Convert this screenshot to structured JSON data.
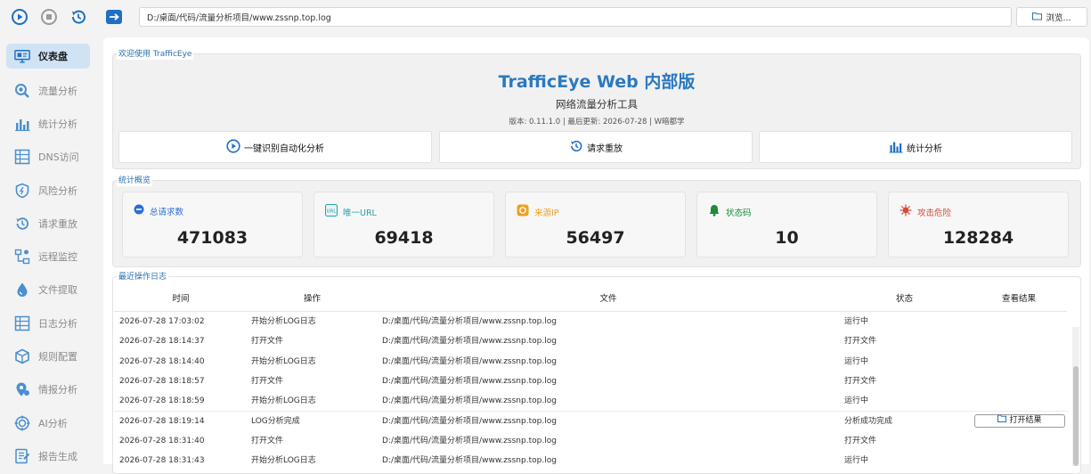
{
  "toolbar": {
    "file_path": "D:/桌面/代码/流量分析项目/www.zssnp.top.log",
    "browse_label": "浏览..."
  },
  "sidebar": {
    "items": [
      {
        "label": "仪表盘",
        "icon": "monitor-icon"
      },
      {
        "label": "流量分析",
        "icon": "magnifier-icon"
      },
      {
        "label": "统计分析",
        "icon": "bar-chart-icon"
      },
      {
        "label": "DNS访问",
        "icon": "grid-icon"
      },
      {
        "label": "风险分析",
        "icon": "shield-icon"
      },
      {
        "label": "请求重放",
        "icon": "history-icon"
      },
      {
        "label": "远程监控",
        "icon": "network-icon"
      },
      {
        "label": "文件提取",
        "icon": "droplet-icon"
      },
      {
        "label": "日志分析",
        "icon": "grid-icon"
      },
      {
        "label": "规则配置",
        "icon": "cube-icon"
      },
      {
        "label": "情报分析",
        "icon": "location-icon"
      },
      {
        "label": "AI分析",
        "icon": "target-icon"
      },
      {
        "label": "报告生成",
        "icon": "report-icon"
      }
    ]
  },
  "welcome": {
    "group_title": "欢迎使用 TrafficEye",
    "title": "TrafficEye Web 内部版",
    "subtitle": "网络流量分析工具",
    "version_line": "版本: 0.11.1.0 | 最后更新: 2026-07-28 | W暗都学",
    "buttons": [
      {
        "label": "一键识别自动化分析",
        "icon": "play-circle-icon"
      },
      {
        "label": "请求重放",
        "icon": "history-icon"
      },
      {
        "label": "统计分析",
        "icon": "bar-chart-icon"
      }
    ]
  },
  "stats": {
    "group_title": "统计概览",
    "cards": [
      {
        "label": "总请求数",
        "value": "471083",
        "color": "#2b6fd6",
        "icon": "circle-dash-icon"
      },
      {
        "label": "唯一URL",
        "value": "69418",
        "color": "#2aa0a8",
        "icon": "url-icon"
      },
      {
        "label": "来源IP",
        "value": "56497",
        "color": "#f0a020",
        "icon": "ip-icon"
      },
      {
        "label": "状态码",
        "value": "10",
        "color": "#1d8c3a",
        "icon": "bell-icon"
      },
      {
        "label": "攻击危险",
        "value": "128284",
        "color": "#d64a3a",
        "icon": "virus-icon"
      }
    ]
  },
  "log": {
    "group_title": "最近操作日志",
    "columns": [
      "时间",
      "操作",
      "文件",
      "状态",
      "查看结果"
    ],
    "rows": [
      {
        "time": "2026-07-28 17:03:02",
        "op": "开始分析LOG日志",
        "file": "D:/桌面/代码/流量分析项目/www.zssnp.top.log",
        "status": "运行中",
        "result": ""
      },
      {
        "time": "2026-07-28 18:14:37",
        "op": "打开文件",
        "file": "D:/桌面/代码/流量分析项目/www.zssnp.top.log",
        "status": "打开文件",
        "result": ""
      },
      {
        "time": "2026-07-28 18:14:40",
        "op": "开始分析LOG日志",
        "file": "D:/桌面/代码/流量分析项目/www.zssnp.top.log",
        "status": "运行中",
        "result": ""
      },
      {
        "time": "2026-07-28 18:18:57",
        "op": "打开文件",
        "file": "D:/桌面/代码/流量分析项目/www.zssnp.top.log",
        "status": "打开文件",
        "result": ""
      },
      {
        "time": "2026-07-28 18:18:59",
        "op": "开始分析LOG日志",
        "file": "D:/桌面/代码/流量分析项目/www.zssnp.top.log",
        "status": "运行中",
        "result": ""
      },
      {
        "time": "2026-07-28 18:19:14",
        "op": "LOG分析完成",
        "file": "D:/桌面/代码/流量分析项目/www.zssnp.top.log",
        "status": "分析成功完成",
        "result": "打开结果"
      },
      {
        "time": "2026-07-28 18:31:40",
        "op": "打开文件",
        "file": "D:/桌面/代码/流量分析项目/www.zssnp.top.log",
        "status": "打开文件",
        "result": ""
      },
      {
        "time": "2026-07-28 18:31:43",
        "op": "开始分析LOG日志",
        "file": "D:/桌面/代码/流量分析项目/www.zssnp.top.log",
        "status": "运行中",
        "result": ""
      }
    ]
  },
  "colors": {
    "accent": "#2b7ac0",
    "group_title": "#2b6fb0",
    "active_nav": "#cfe3f5"
  }
}
